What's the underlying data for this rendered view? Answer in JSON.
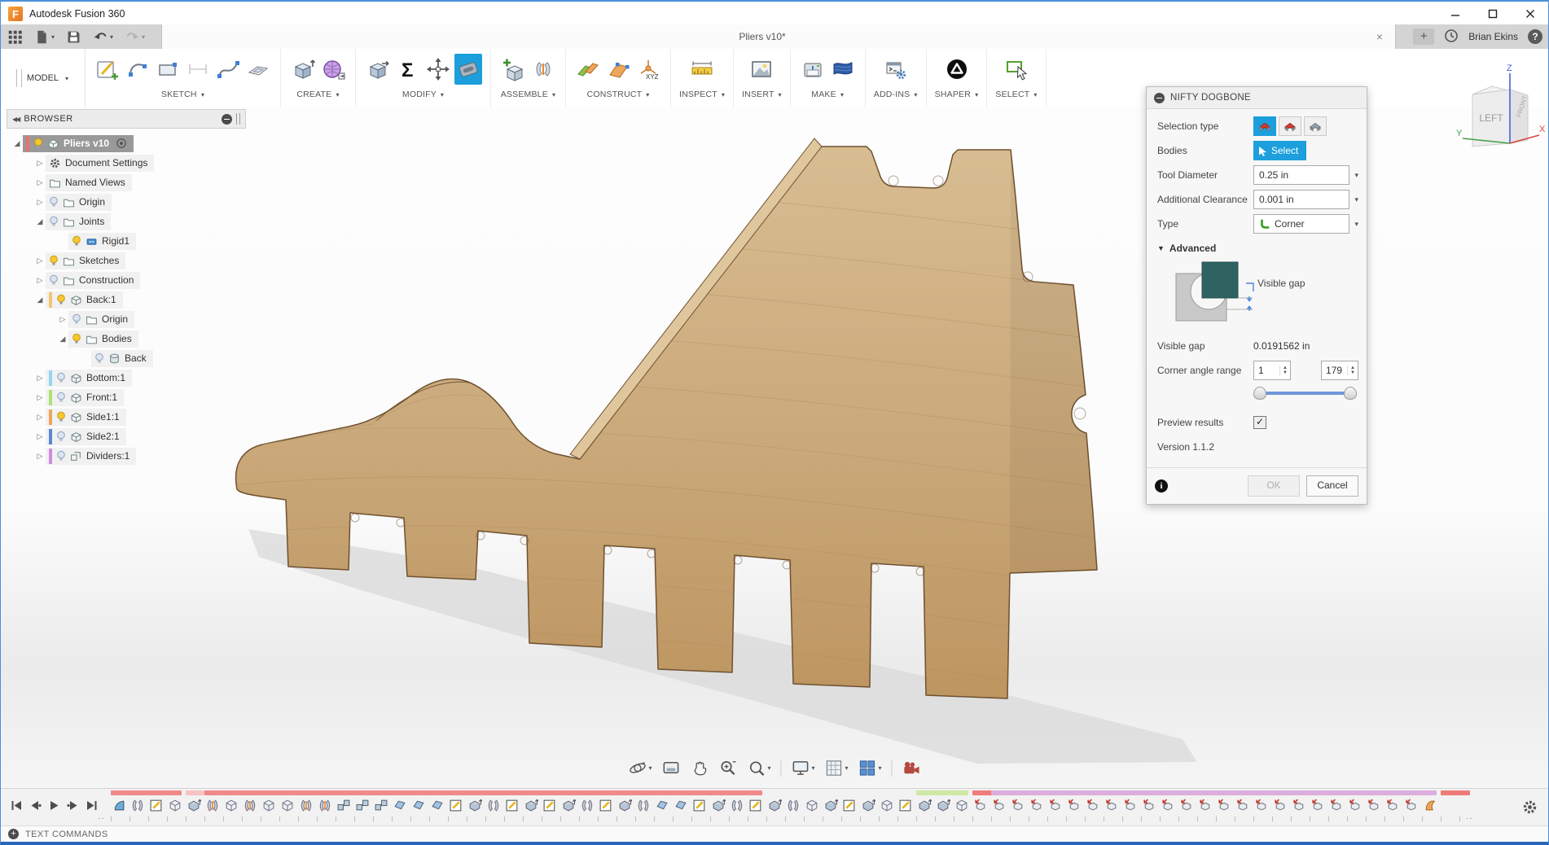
{
  "app": {
    "title": "Autodesk Fusion 360"
  },
  "qat": {
    "icons": [
      {
        "name": "app-grid"
      },
      {
        "name": "file-new",
        "caret": true
      },
      {
        "name": "save"
      },
      {
        "name": "undo",
        "caret": true
      },
      {
        "name": "redo",
        "caret": true,
        "disabled": true
      }
    ],
    "tab_title": "Pliers v10*",
    "user": "Brian Ekins"
  },
  "toolbar": {
    "workspace": "MODEL",
    "groups": [
      {
        "label": "SKETCH",
        "items": [
          {
            "name": "create-sketch"
          },
          {
            "name": "arc"
          },
          {
            "name": "rectangle"
          },
          {
            "name": "sketch-dimension",
            "disabled": true
          },
          {
            "name": "spline"
          },
          {
            "name": "project"
          }
        ]
      },
      {
        "label": "CREATE",
        "items": [
          {
            "name": "extrude"
          },
          {
            "name": "form"
          }
        ]
      },
      {
        "label": "MODIFY",
        "items": [
          {
            "name": "press-pull"
          },
          {
            "name": "sigma-parameters"
          },
          {
            "name": "move"
          },
          {
            "name": "dogbone",
            "selected": true
          }
        ]
      },
      {
        "label": "ASSEMBLE",
        "items": [
          {
            "name": "new-component"
          },
          {
            "name": "joint"
          }
        ]
      },
      {
        "label": "CONSTRUCT",
        "items": [
          {
            "name": "plane-offset"
          },
          {
            "name": "plane-angle"
          },
          {
            "name": "axis-xyz"
          }
        ]
      },
      {
        "label": "INSPECT",
        "items": [
          {
            "name": "measure"
          }
        ]
      },
      {
        "label": "INSERT",
        "items": [
          {
            "name": "insert-image"
          }
        ]
      },
      {
        "label": "MAKE",
        "items": [
          {
            "name": "print-3d"
          },
          {
            "name": "cam-flag"
          }
        ]
      },
      {
        "label": "ADD-INS",
        "items": [
          {
            "name": "scripts-addins"
          }
        ]
      },
      {
        "label": "SHAPER",
        "items": [
          {
            "name": "shaper-utilities"
          }
        ]
      },
      {
        "label": "SELECT",
        "items": [
          {
            "name": "select-tool"
          }
        ]
      }
    ]
  },
  "browser": {
    "header": "BROWSER",
    "tree": [
      {
        "label": "Pliers v10",
        "level": 0,
        "expand": "open",
        "bulb": "on",
        "icon": "component",
        "bar": "#e87070",
        "selected": true,
        "radio": true
      },
      {
        "label": "Document Settings",
        "level": 1,
        "expand": "closed",
        "bulb": null,
        "icon": "gear"
      },
      {
        "label": "Named Views",
        "level": 1,
        "expand": "closed",
        "bulb": null,
        "icon": "folder"
      },
      {
        "label": "Origin",
        "level": 1,
        "expand": "closed",
        "bulb": "off",
        "icon": "folder"
      },
      {
        "label": "Joints",
        "level": 1,
        "expand": "open",
        "bulb": "off",
        "icon": "folder"
      },
      {
        "label": "Rigid1",
        "level": 2,
        "expand": null,
        "bulb": "on",
        "icon": "joint-sm"
      },
      {
        "label": "Sketches",
        "level": 1,
        "expand": "closed",
        "bulb": "on",
        "icon": "folder"
      },
      {
        "label": "Construction",
        "level": 1,
        "expand": "closed",
        "bulb": "off",
        "icon": "folder"
      },
      {
        "label": "Back:1",
        "level": 1,
        "expand": "open",
        "bulb": "on",
        "icon": "component",
        "bar": "#f2c572"
      },
      {
        "label": "Origin",
        "level": 2,
        "expand": "closed",
        "bulb": "off",
        "icon": "folder"
      },
      {
        "label": "Bodies",
        "level": 2,
        "expand": "open",
        "bulb": "on",
        "icon": "folder"
      },
      {
        "label": "Back",
        "level": 3,
        "expand": null,
        "bulb": "off",
        "icon": "body"
      },
      {
        "label": "Bottom:1",
        "level": 1,
        "expand": "closed",
        "bulb": "off",
        "icon": "component",
        "bar": "#93d6f2"
      },
      {
        "label": "Front:1",
        "level": 1,
        "expand": "closed",
        "bulb": "off",
        "icon": "component",
        "bar": "#abe272"
      },
      {
        "label": "Side1:1",
        "level": 1,
        "expand": "closed",
        "bulb": "on",
        "icon": "component",
        "bar": "#f2a45a"
      },
      {
        "label": "Side2:1",
        "level": 1,
        "expand": "closed",
        "bulb": "off",
        "icon": "component",
        "bar": "#5c86d6"
      },
      {
        "label": "Dividers:1",
        "level": 1,
        "expand": "closed",
        "bulb": "off",
        "icon": "components",
        "bar": "#cf8ae2"
      }
    ]
  },
  "viewcube": {
    "face_left": "LEFT",
    "face_front": "FRONT",
    "axis_x": "X",
    "axis_y": "Y",
    "axis_z": "Z"
  },
  "navbar": {
    "items": [
      {
        "name": "orbit",
        "caret": true
      },
      {
        "name": "look-at"
      },
      {
        "name": "pan"
      },
      {
        "name": "zoom"
      },
      {
        "name": "fit",
        "caret": true
      },
      {
        "name": "sep"
      },
      {
        "name": "display-settings",
        "caret": true
      },
      {
        "name": "grid-settings",
        "caret": true
      },
      {
        "name": "viewports",
        "caret": true
      },
      {
        "name": "sep"
      },
      {
        "name": "capture-image"
      }
    ]
  },
  "dialog": {
    "title": "NIFTY DOGBONE",
    "accent": "#0696d7",
    "selection_type": {
      "label": "Selection type",
      "options": [
        {
          "name": "selection-option-1",
          "style": "red",
          "selected": true
        },
        {
          "name": "selection-option-2",
          "style": "red"
        },
        {
          "name": "selection-option-3",
          "style": "gray"
        }
      ]
    },
    "bodies": {
      "label": "Bodies",
      "button": "Select"
    },
    "tool_diameter": {
      "label": "Tool Diameter",
      "value": "0.25 in"
    },
    "additional_clearance": {
      "label": "Additional Clearance",
      "value": "0.001 in"
    },
    "type": {
      "label": "Type",
      "value": "Corner"
    },
    "advanced": {
      "label": "Advanced",
      "diagram_caption": "Visible gap",
      "visible_gap_label": "Visible gap",
      "visible_gap_value": "0.0191562 in",
      "corner_angle_label": "Corner angle range",
      "corner_angle_min": "1",
      "corner_angle_max": "179"
    },
    "preview": {
      "label": "Preview results",
      "checked": true
    },
    "version": "Version 1.1.2",
    "buttons": {
      "ok": "OK",
      "cancel": "Cancel"
    }
  },
  "timeline": {
    "playback": [
      "go-to-start",
      "step-back",
      "play",
      "step-forward",
      "go-to-end"
    ],
    "icons": [
      "fillet",
      "mirror",
      "sketch",
      "box",
      "extrude",
      "joint",
      "box",
      "joint",
      "box",
      "box",
      "joint",
      "joint",
      "link",
      "link",
      "link",
      "chamfer",
      "chamfer",
      "chamfer",
      "sketch",
      "extrude",
      "mirror",
      "sketch",
      "extrude",
      "sketch",
      "extrude",
      "mirror",
      "sketch",
      "extrude",
      "mirror",
      "chamfer",
      "chamfer",
      "sketch",
      "extrude",
      "mirror",
      "sketch",
      "extrude",
      "mirror",
      "box",
      "extrude",
      "sketch",
      "extrude",
      "box",
      "sketch",
      "extrude",
      "extrude",
      "box",
      "combine",
      "combine",
      "combine",
      "combine",
      "combine",
      "combine",
      "combine",
      "combine",
      "combine",
      "combine",
      "combine",
      "combine",
      "combine",
      "combine",
      "combine",
      "combine",
      "combine",
      "combine",
      "combine",
      "combine",
      "combine",
      "combine",
      "combine",
      "combine",
      "loft"
    ],
    "bars": [
      {
        "from": 0,
        "to": 3,
        "color": "#ef8a88"
      },
      {
        "from": 4,
        "to": 4.4,
        "color": "#f8c3c3"
      },
      {
        "from": 5,
        "to": 34,
        "color": "#ef8a88"
      },
      {
        "from": 43,
        "to": 45,
        "color": "#cfe9a4"
      },
      {
        "from": 46,
        "to": 46.6,
        "color": "#ee7c78"
      },
      {
        "from": 47,
        "to": 70,
        "color": "#dcaede"
      },
      {
        "from": 71,
        "to": 71.8,
        "color": "#ee7c78"
      }
    ]
  },
  "statusbar": {
    "label": "TEXT COMMANDS"
  },
  "scene": {
    "part": "wood-pliers-side-panel",
    "wood_color": "#c9a97c",
    "wood_light": "#d8bd92",
    "wood_dark": "#bd9560",
    "edge_color": "#6f5130",
    "shadow_color": "#dadada",
    "diagram_teal": "#2e6361"
  }
}
